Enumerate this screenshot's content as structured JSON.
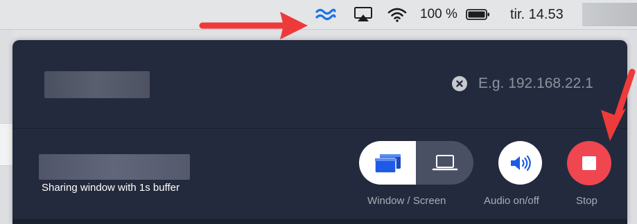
{
  "menubar": {
    "icons": [
      "wave-icon",
      "airplay-icon",
      "wifi-icon",
      "battery-icon"
    ],
    "battery_percent": "100 %",
    "clock": "tir. 14.53",
    "accent_color": "#1a73e8"
  },
  "connection": {
    "ip_placeholder": "E.g. 192.168.22.1",
    "clear_icon": "close-circle-icon"
  },
  "sharing": {
    "status": "Sharing window with 1s buffer",
    "mode_label": "Window / Screen",
    "audio_label": "Audio on/off",
    "stop_label": "Stop",
    "stop_color": "#ef4650",
    "mode_selected": "Window"
  },
  "annotations": {
    "arrow_color": "#ee3a3a"
  }
}
